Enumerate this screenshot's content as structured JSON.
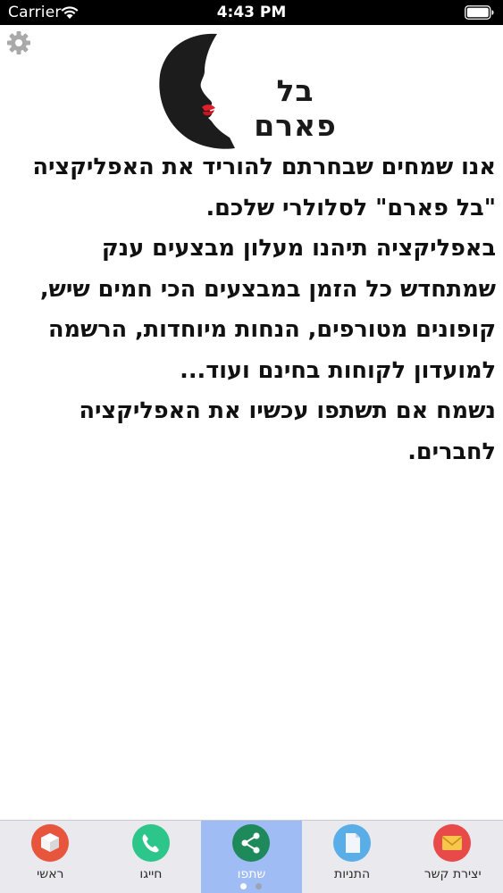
{
  "status_bar": {
    "carrier": "Carrier",
    "time": "4:43 PM",
    "wifi_icon": "wifi-icon",
    "battery_icon": "battery-icon"
  },
  "settings_icon": "gear-icon",
  "logo": {
    "text": "בל פארם",
    "icon": "woman-face-profile-logo"
  },
  "content": {
    "paragraphs": [
      "אנו שמחים שבחרתם להוריד את האפליקציה \"בל פארם\" לסלולרי שלכם.",
      "באפליקציה תיהנו מעלון מבצעים ענק שמתחדש כל הזמן במבצעים הכי חמים שיש, קופונים מטורפים, הנחות מיוחדות, הרשמה למועדון לקוחות בחינם ועוד...",
      "נשמח אם תשתפו עכשיו את האפליקציה לחברים."
    ]
  },
  "tab_bar": {
    "tabs": [
      {
        "label": "ראשי",
        "icon": "cube-icon",
        "color": "#e8553d",
        "active": false
      },
      {
        "label": "חייגו",
        "icon": "phone-icon",
        "color": "#2cc68a",
        "active": false
      },
      {
        "label": "שתפו",
        "icon": "share-icon",
        "color": "#1e8a5b",
        "active": true
      },
      {
        "label": "התניות",
        "icon": "document-icon",
        "color": "#5aaee8",
        "active": false
      },
      {
        "label": "יצירת קשר",
        "icon": "envelope-icon",
        "color": "#e84a4a",
        "active": false
      }
    ],
    "active_color": "#9fbdf4",
    "page_indicator": {
      "count": 2,
      "current": 1
    }
  }
}
